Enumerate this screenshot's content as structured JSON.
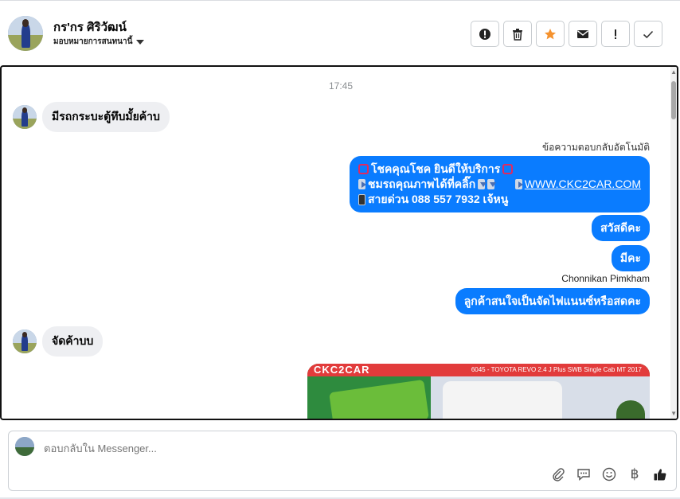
{
  "header": {
    "contact_name": "กร'กร ศิริวัฒน์",
    "assign_label": "มอบหมายการสนทนานี้",
    "actions": [
      {
        "icon": "alert-circle-icon",
        "label": "spam"
      },
      {
        "icon": "trash-icon",
        "label": "delete"
      },
      {
        "icon": "star-icon",
        "label": "star"
      },
      {
        "icon": "envelope-icon",
        "label": "mark-unread"
      },
      {
        "icon": "exclamation-icon",
        "label": "follow-up"
      },
      {
        "icon": "check-icon",
        "label": "done"
      }
    ],
    "star_color": "#f5922e"
  },
  "chat": {
    "timestamp": "17:45",
    "incoming_1": "มีรถกระบะตู้ทึบมั้ยค้าบ",
    "auto_reply_label": "ข้อความตอบกลับอัตโนมัติ",
    "auto_reply": {
      "line1": "โชคคุณโชค ยินดีให้บริการ",
      "line2_text": "ชมรถคุณภาพได้ที่คลิ๊ก",
      "line2_link": "WWW.CKC2CAR.COM",
      "line3": "สายด่วน 088 557 7932 เจ้หนู"
    },
    "out_2": "สวัสดีคะ",
    "out_3": "มีคะ",
    "sender_name": "Chonnikan Pimkham",
    "out_4": "ลูกค้าสนใจเป็นจัดไฟแนนซ์หรือสดคะ",
    "incoming_2": "จัดค้าบบ",
    "image_card": {
      "brand": "CKC2CAR",
      "caption": "6045 - TOYOTA REVO 2.4 J Plus SWB Single Cab MT 2017"
    },
    "bubble_color": "#0a7cff"
  },
  "composer": {
    "placeholder": "ตอบกลับใน Messenger...",
    "tools": [
      "paperclip-icon",
      "saved-reply-icon",
      "emoji-icon",
      "baht-icon",
      "thumbs-up-icon"
    ],
    "baht_symbol": "฿"
  }
}
